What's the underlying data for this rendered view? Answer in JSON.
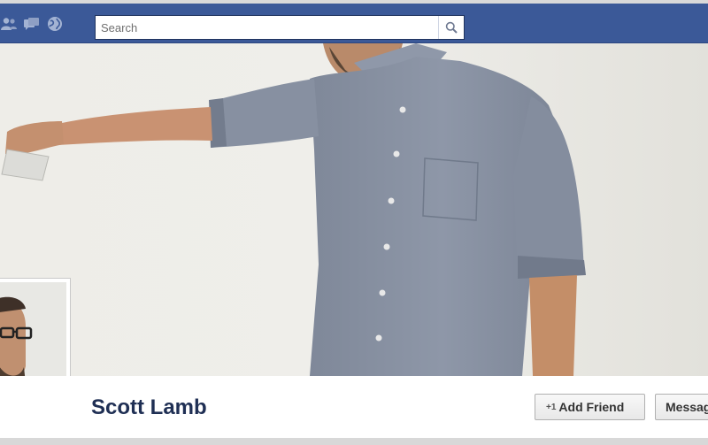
{
  "topbar": {
    "jewels": [
      "friend-requests-icon",
      "messages-icon",
      "notifications-globe-icon"
    ],
    "search": {
      "placeholder": "Search",
      "icon": "search-icon"
    },
    "brand_color": "#3b5998"
  },
  "cover": {
    "description_icon": "cover-photo"
  },
  "profile": {
    "name": "Scott Lamb",
    "buttons": {
      "add_friend": {
        "label": "Add Friend",
        "icon": "+1"
      },
      "message": {
        "label": "Message"
      }
    }
  }
}
